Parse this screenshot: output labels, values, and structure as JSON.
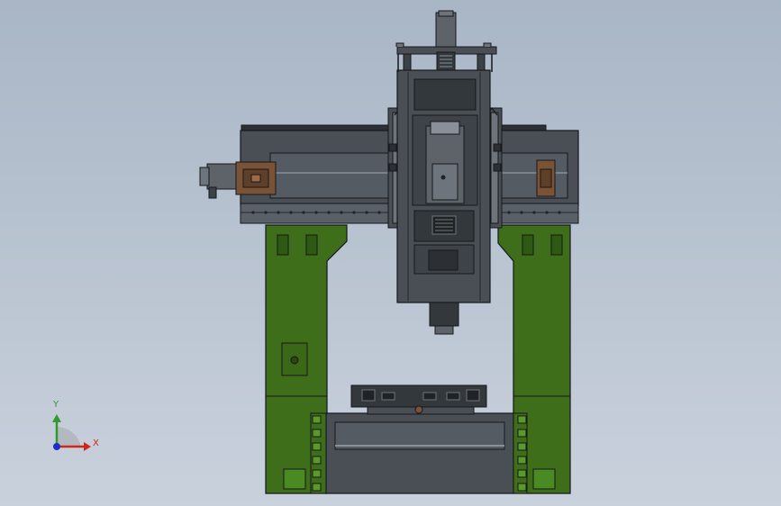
{
  "viewport": {
    "background_top": "#a9b6c6",
    "background_bottom": "#c9d1dc"
  },
  "model": {
    "frame_green": "#3e6e1a",
    "frame_green_dark": "#27480d",
    "steel_gray": "#4a4f55",
    "steel_light": "#6e747b",
    "steel_dark": "#2c3035",
    "bronze": "#7a5236",
    "outline": "#15181b"
  },
  "triad": {
    "x_label": "X",
    "y_label": "Y",
    "x_color": "#d0271d",
    "y_color": "#2e9b2a",
    "z_color": "#1c2fc9"
  }
}
